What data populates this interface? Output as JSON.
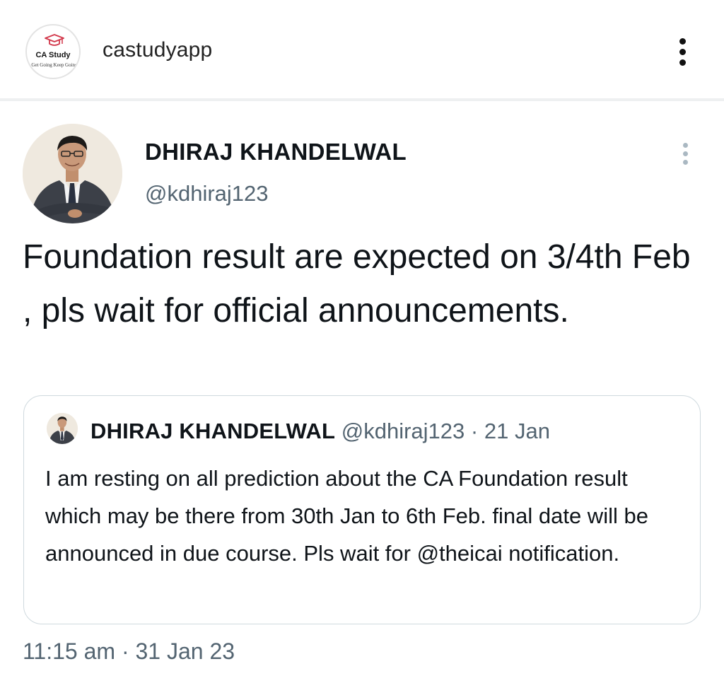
{
  "header": {
    "avatar_brand": "CA Study",
    "avatar_tagline": "Get Going Keep Going",
    "username": "castudyapp",
    "menu_icon": "more-vertical-icon"
  },
  "tweet": {
    "author_name": "DHIRAJ KHANDELWAL",
    "author_handle": "@kdhiraj123",
    "menu_icon": "more-vertical-icon",
    "text": "Foundation result are expected on 3/4th Feb , pls wait for official announcements.",
    "timestamp": "11:15 am · 31 Jan 23"
  },
  "quoted_tweet": {
    "author_name": "DHIRAJ KHANDELWAL",
    "author_handle": "@kdhiraj123",
    "separator": "·",
    "date": "21 Jan",
    "text": "I am resting on all prediction about the CA Foundation result which may be there from 30th Jan to 6th Feb. final date will be announced in due course. Pls wait for @theicai notification."
  },
  "colors": {
    "text_primary": "#0f1419",
    "text_secondary": "#536471",
    "card_border": "#cfd9de",
    "divider": "#eef0f1"
  }
}
